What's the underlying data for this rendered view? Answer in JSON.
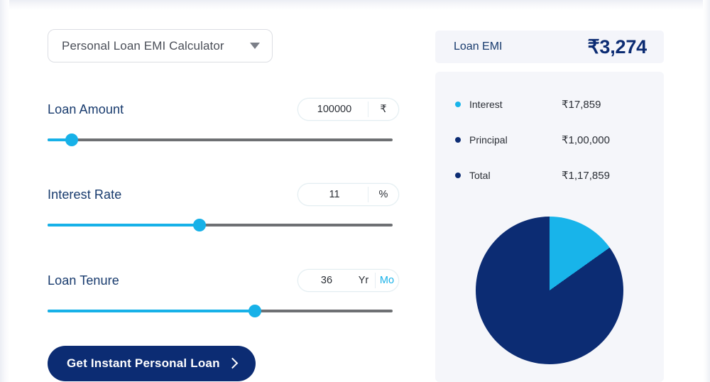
{
  "calculator": {
    "product_select": {
      "selected": "Personal Loan EMI Calculator",
      "caret_icon": "chevron-down-icon"
    },
    "fields": [
      {
        "label": "Loan Amount",
        "value": "100000",
        "unit": "₹",
        "slider_percent": 7
      },
      {
        "label": "Interest Rate",
        "value": "11",
        "unit": "%",
        "slider_percent": 44
      },
      {
        "label": "Loan Tenure",
        "value": "36",
        "unit_options": [
          "Yr",
          "Mo"
        ],
        "unit_selected": "Mo",
        "slider_percent": 60
      }
    ],
    "cta": {
      "label": "Get Instant Personal Loan",
      "icon": "chevron-right-icon"
    }
  },
  "result": {
    "emi": {
      "label": "Loan EMI",
      "value": "₹3,274"
    },
    "breakdown": [
      {
        "name": "Interest",
        "amount": "₹17,859",
        "color": "#18b4ea"
      },
      {
        "name": "Principal",
        "amount": "₹1,00,000",
        "color": "#0c2c73"
      },
      {
        "name": "Total",
        "amount": "₹1,17,859",
        "color": "#0c2c73"
      }
    ]
  },
  "chart_data": {
    "type": "pie",
    "title": "",
    "labels": [
      "Interest",
      "Principal"
    ],
    "values": [
      17859,
      100000
    ],
    "percentages": [
      15.2,
      84.8
    ],
    "colors": [
      "#18b4ea",
      "#0c2c73"
    ],
    "start_angle_deg": 0,
    "direction": "clockwise",
    "legend": "left",
    "total": 117859
  },
  "theme": {
    "accent_cyan": "#17b1e8",
    "navy": "#0c2c73",
    "label_navy": "#173a6d",
    "panel_bg": "#f5f6fa",
    "track_gray": "#6e7073"
  }
}
